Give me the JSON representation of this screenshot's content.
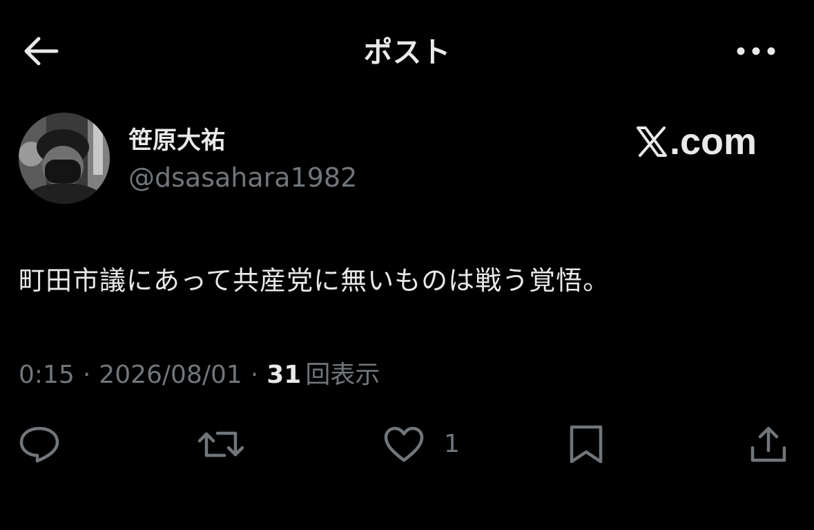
{
  "header": {
    "title": "ポスト",
    "back_icon": "arrow-left-icon",
    "more_icon": "more-horizontal-icon"
  },
  "author": {
    "display_name": "笹原大祐",
    "handle": "@dsasahara1982"
  },
  "brand": {
    "logo_text": ".com",
    "logo_icon": "x-logo-icon"
  },
  "post": {
    "text": "町田市議にあって共産党に無いものは戦う覚悟。"
  },
  "meta": {
    "time": "0:15",
    "separator": "·",
    "date": "2026/08/01",
    "view_count": "31",
    "view_label": "回表示"
  },
  "actions": {
    "reply_icon": "reply-icon",
    "repost_icon": "repost-icon",
    "like_icon": "heart-icon",
    "like_count": "1",
    "bookmark_icon": "bookmark-icon",
    "share_icon": "share-icon"
  },
  "colors": {
    "background": "#000000",
    "primary_text": "#e7e9ea",
    "secondary_text": "#71767b"
  }
}
